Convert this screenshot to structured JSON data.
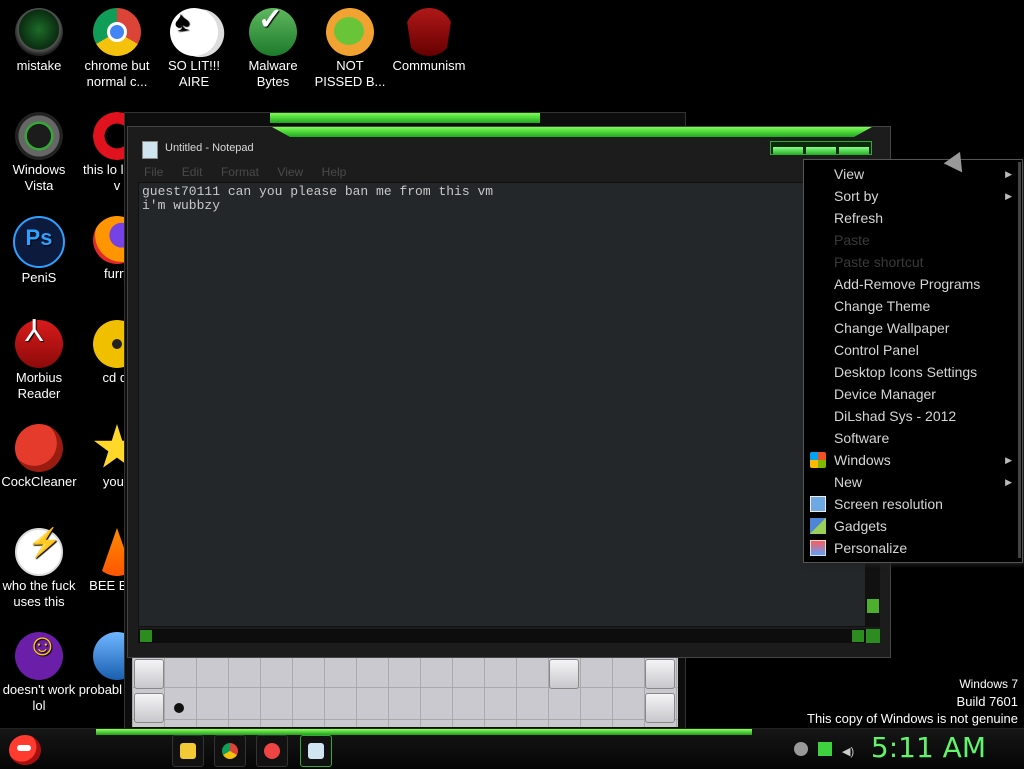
{
  "desktop_icons": [
    {
      "label": "mistake",
      "icon": "mistake-icon"
    },
    {
      "label": "chrome but normal c...",
      "icon": "chrome-icon"
    },
    {
      "label": "SO LIT!!! AIRE",
      "icon": "solitaire-icon"
    },
    {
      "label": "Malware Bytes",
      "icon": "malwarebytes-icon"
    },
    {
      "label": "NOT PISSED B...",
      "icon": "bad-piggies-icon"
    },
    {
      "label": "Communism",
      "icon": "communism-icon"
    },
    {
      "label": "Windows Vista",
      "icon": "windows-vista-icon"
    },
    {
      "label": "this lo like a v",
      "icon": "opera-icon"
    },
    {
      "label": "PeniS",
      "icon": "photoshop-icon"
    },
    {
      "label": "furry",
      "icon": "firefox-icon"
    },
    {
      "label": "Morbius Reader",
      "icon": "adobe-reader-icon"
    },
    {
      "label": "cd dr",
      "icon": "cd-icon"
    },
    {
      "label": "CockCleaner",
      "icon": "ccleaner-icon"
    },
    {
      "label": "you t",
      "icon": "star-icon"
    },
    {
      "label": "who the fuck uses this",
      "icon": "bolt-icon"
    },
    {
      "label": "BEE BEE",
      "icon": "vlc-icon"
    },
    {
      "label": "doesn't work lol",
      "icon": "yahoo-icon"
    },
    {
      "label": "probabl a rog",
      "icon": "monitor-icon"
    }
  ],
  "notepad": {
    "title": "Untitled - Notepad",
    "menu": [
      "File",
      "Edit",
      "Format",
      "View",
      "Help"
    ],
    "text": "guest70111 can you please ban me from this vm\ni'm wubbzy"
  },
  "context_menu": {
    "items": [
      {
        "label": "View",
        "submenu": true,
        "enabled": true
      },
      {
        "label": "Sort by",
        "submenu": true,
        "enabled": true
      },
      {
        "label": "Refresh",
        "submenu": false,
        "enabled": true
      },
      {
        "label": "Paste",
        "submenu": false,
        "enabled": false
      },
      {
        "label": "Paste shortcut",
        "submenu": false,
        "enabled": false
      },
      {
        "label": "Add-Remove Programs",
        "submenu": false,
        "enabled": true
      },
      {
        "label": "Change Theme",
        "submenu": false,
        "enabled": true
      },
      {
        "label": "Change Wallpaper",
        "submenu": false,
        "enabled": true
      },
      {
        "label": "Control Panel",
        "submenu": false,
        "enabled": true
      },
      {
        "label": "Desktop Icons Settings",
        "submenu": false,
        "enabled": true
      },
      {
        "label": "Device Manager",
        "submenu": false,
        "enabled": true
      },
      {
        "label": "DiLshad Sys - 2012",
        "submenu": false,
        "enabled": true
      },
      {
        "label": "Software",
        "submenu": false,
        "enabled": true
      },
      {
        "label": "Windows",
        "submenu": true,
        "enabled": true,
        "icon": "windows-logo-icon"
      },
      {
        "label": "New",
        "submenu": true,
        "enabled": true
      },
      {
        "label": "Screen resolution",
        "submenu": false,
        "enabled": true,
        "icon": "screen-resolution-icon"
      },
      {
        "label": "Gadgets",
        "submenu": false,
        "enabled": true,
        "icon": "gadgets-icon"
      },
      {
        "label": "Personalize",
        "submenu": false,
        "enabled": true,
        "icon": "personalize-icon"
      }
    ]
  },
  "watermark": {
    "line1": "Windows 7",
    "line2": "Build 7601",
    "line3": "This copy of Windows is not genuine"
  },
  "taskbar": {
    "clock": "5:11 AM",
    "buttons": [
      "file-explorer-icon",
      "chrome-icon",
      "ccleaner-icon",
      "notepad-icon"
    ]
  },
  "colors": {
    "accent_green": "#4fd62f",
    "clock_green": "#62f26b",
    "desktop_bg": "#000000"
  }
}
